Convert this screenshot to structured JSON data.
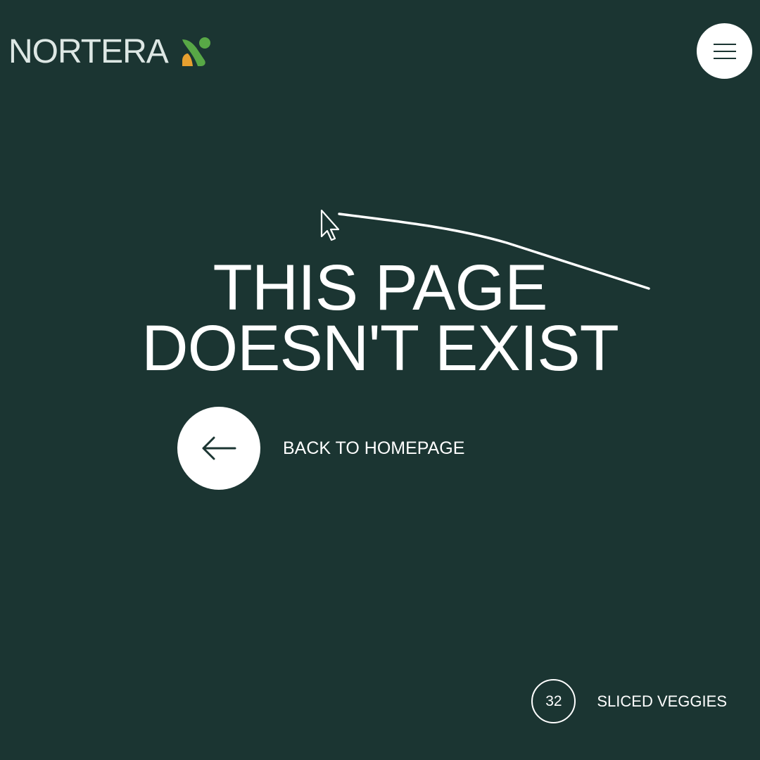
{
  "header": {
    "logo_text": "NORTERA",
    "logo_icon": "nortera-leaf-mark",
    "menu_icon": "hamburger-icon"
  },
  "colors": {
    "background": "#1b3532",
    "text": "#ffffff",
    "logo_text": "#dde7e4",
    "logo_green": "#58a846",
    "logo_orange": "#e7a02f"
  },
  "main": {
    "headline_line1": "THIS PAGE",
    "headline_line2": "DOESN'T EXIST",
    "back_label": "BACK TO HOMEPAGE",
    "back_icon": "arrow-left-icon"
  },
  "footer": {
    "count": "32",
    "count_label": "SLICED VEGGIES"
  }
}
